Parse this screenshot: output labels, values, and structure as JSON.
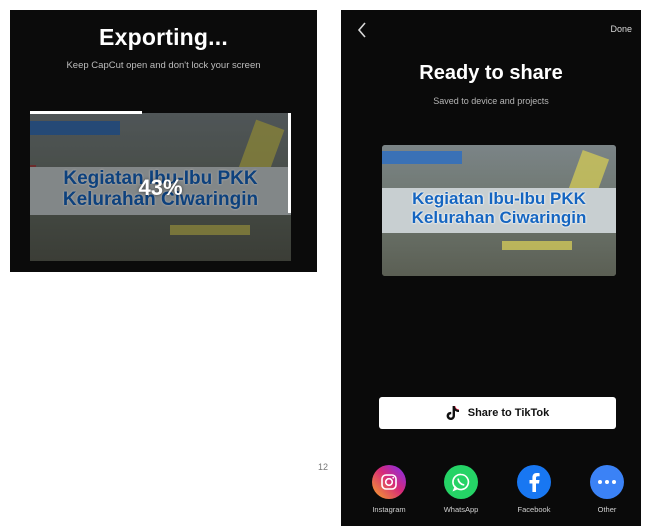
{
  "export": {
    "title": "Exporting...",
    "subtitle": "Keep CapCut open and don't lock your screen",
    "progress_percent": "43%",
    "progress_fraction": 0.43,
    "thumbnail_text_line1": "Kegiatan Ibu-Ibu PKK",
    "thumbnail_text_line2": "Kelurahan Ciwaringin"
  },
  "share": {
    "back_icon": "chevron-left-icon",
    "done_label": "Done",
    "title": "Ready to share",
    "subtitle": "Saved to device and projects",
    "thumbnail_text_line1": "Kegiatan Ibu-Ibu PKK",
    "thumbnail_text_line2": "Kelurahan Ciwaringin",
    "tiktok_label": "Share to TikTok",
    "targets": [
      {
        "label": "Instagram",
        "icon": "instagram-icon",
        "color": "#d6297a"
      },
      {
        "label": "WhatsApp",
        "icon": "whatsapp-icon",
        "color": "#25d366"
      },
      {
        "label": "Facebook",
        "icon": "facebook-icon",
        "color": "#1877f2"
      },
      {
        "label": "Other",
        "icon": "more-icon",
        "color": "#3b82f6"
      }
    ]
  },
  "page_number": "12"
}
